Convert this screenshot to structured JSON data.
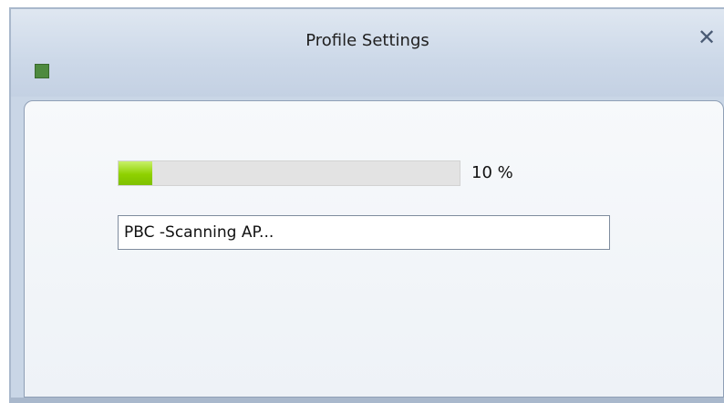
{
  "window": {
    "title": "Profile Settings",
    "close_symbol": "✕"
  },
  "progress": {
    "value": 0.1,
    "label": "10 %"
  },
  "status_field": {
    "value": "PBC -Scanning AP..."
  },
  "colors": {
    "titlebar": "#ccd8e8",
    "progress_fill": "#8fd100",
    "status_square": "#4e8a3f",
    "close_icon": "#4a5b74"
  },
  "icons": {
    "close": "close-icon",
    "status": "status-square-icon"
  }
}
